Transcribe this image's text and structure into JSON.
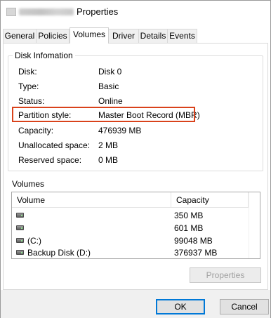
{
  "window": {
    "title": "Properties",
    "title_blurred_prefix": "",
    "accent_color": "#0078d7",
    "highlight_color": "#d9421b"
  },
  "tabs": [
    {
      "label": "General",
      "active": false
    },
    {
      "label": "Policies",
      "active": false
    },
    {
      "label": "Volumes",
      "active": true
    },
    {
      "label": "Driver",
      "active": false
    },
    {
      "label": "Details",
      "active": false
    },
    {
      "label": "Events",
      "active": false
    }
  ],
  "disk_info": {
    "group_title": "Disk Infomation",
    "rows": [
      {
        "label": "Disk:",
        "value": "Disk 0"
      },
      {
        "label": "Type:",
        "value": "Basic"
      },
      {
        "label": "Status:",
        "value": "Online"
      },
      {
        "label": "Partition style:",
        "value": "Master Boot Record (MBR)"
      },
      {
        "label": "Capacity:",
        "value": "476939 MB"
      },
      {
        "label": "Unallocated space:",
        "value": "2 MB"
      },
      {
        "label": "Reserved space:",
        "value": "0 MB"
      }
    ]
  },
  "volumes": {
    "group_title": "Volumes",
    "columns": [
      "Volume",
      "Capacity"
    ],
    "rows": [
      {
        "volume": "",
        "capacity": "350 MB",
        "icon": "drive-icon"
      },
      {
        "volume": "",
        "capacity": "601 MB",
        "icon": "drive-icon"
      },
      {
        "volume": "(C:)",
        "capacity": "99048 MB",
        "icon": "drive-icon"
      },
      {
        "volume": "Backup Disk (D:)",
        "capacity": "376937 MB",
        "icon": "drive-icon"
      }
    ],
    "properties_button": "Properties"
  },
  "footer": {
    "ok_label": "OK",
    "cancel_label": "Cancel"
  }
}
